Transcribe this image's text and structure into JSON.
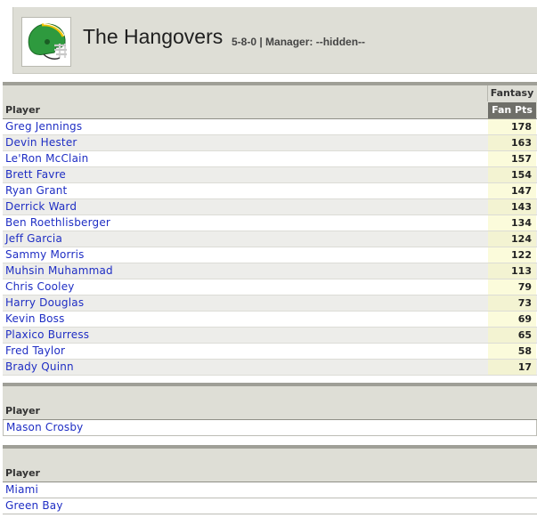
{
  "team": {
    "name": "The Hangovers",
    "record_manager": "5-8-0 | Manager: --hidden--"
  },
  "starters": {
    "player_header": "Player",
    "group_header": "Fantasy",
    "points_header": "Fan Pts",
    "rows": [
      {
        "name": "Greg Jennings",
        "pts": "178"
      },
      {
        "name": "Devin Hester",
        "pts": "163"
      },
      {
        "name": "Le'Ron McClain",
        "pts": "157"
      },
      {
        "name": "Brett Favre",
        "pts": "154"
      },
      {
        "name": "Ryan Grant",
        "pts": "147"
      },
      {
        "name": "Derrick Ward",
        "pts": "143"
      },
      {
        "name": "Ben Roethlisberger",
        "pts": "134"
      },
      {
        "name": "Jeff Garcia",
        "pts": "124"
      },
      {
        "name": "Sammy Morris",
        "pts": "122"
      },
      {
        "name": "Muhsin Muhammad",
        "pts": "113"
      },
      {
        "name": "Chris Cooley",
        "pts": "79"
      },
      {
        "name": "Harry Douglas",
        "pts": "73"
      },
      {
        "name": "Kevin Boss",
        "pts": "69"
      },
      {
        "name": "Plaxico Burress",
        "pts": "65"
      },
      {
        "name": "Fred Taylor",
        "pts": "58"
      },
      {
        "name": "Brady Quinn",
        "pts": "17"
      }
    ]
  },
  "kickers": {
    "player_header": "Player",
    "rows": [
      {
        "name": "Mason Crosby"
      }
    ]
  },
  "defenses": {
    "player_header": "Player",
    "rows": [
      {
        "name": "Miami"
      },
      {
        "name": "Green Bay"
      }
    ]
  },
  "colors": {
    "link": "#1f2ec4",
    "header_bg": "#deded6",
    "points_bg": "#fbfbdb",
    "helmet": "#2e9a3e"
  }
}
